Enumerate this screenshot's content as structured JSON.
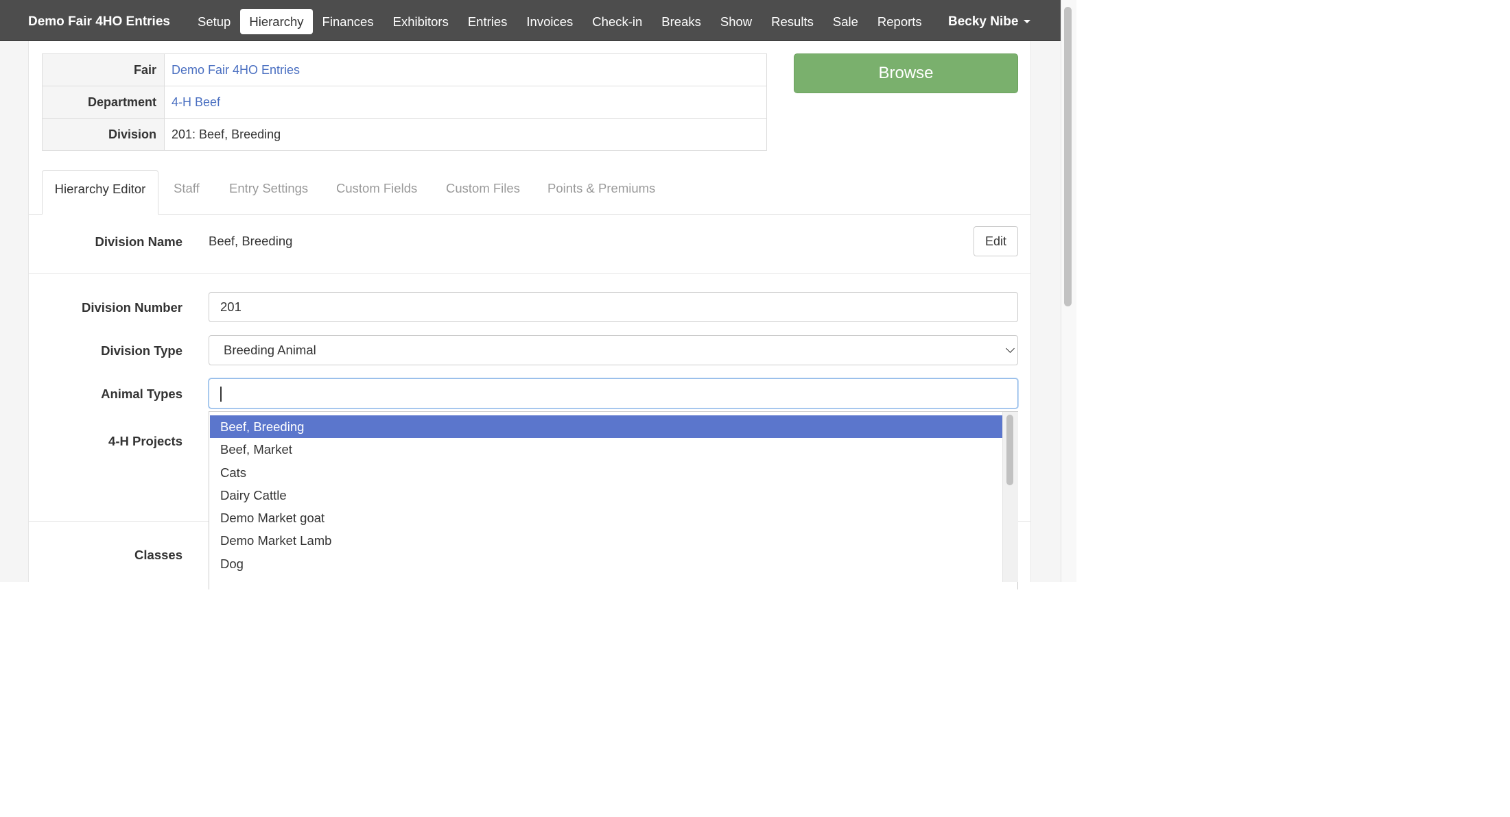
{
  "navbar": {
    "brand": "Demo Fair 4HO Entries",
    "items": [
      {
        "label": "Setup",
        "active": false
      },
      {
        "label": "Hierarchy",
        "active": true
      },
      {
        "label": "Finances",
        "active": false
      },
      {
        "label": "Exhibitors",
        "active": false
      },
      {
        "label": "Entries",
        "active": false
      },
      {
        "label": "Invoices",
        "active": false
      },
      {
        "label": "Check-in",
        "active": false
      },
      {
        "label": "Breaks",
        "active": false
      },
      {
        "label": "Show",
        "active": false
      },
      {
        "label": "Results",
        "active": false
      },
      {
        "label": "Sale",
        "active": false
      },
      {
        "label": "Reports",
        "active": false
      }
    ],
    "user": "Becky Nibe",
    "user_menu_icon": "caret-down-icon"
  },
  "info": {
    "fair_label": "Fair",
    "fair_value": "Demo Fair 4HO Entries",
    "department_label": "Department",
    "department_value": "4-H Beef",
    "division_label": "Division",
    "division_value": "201: Beef, Breeding"
  },
  "browse_button": "Browse",
  "tabs": [
    {
      "label": "Hierarchy Editor",
      "active": true
    },
    {
      "label": "Staff",
      "active": false
    },
    {
      "label": "Entry Settings",
      "active": false
    },
    {
      "label": "Custom Fields",
      "active": false
    },
    {
      "label": "Custom Files",
      "active": false
    },
    {
      "label": "Points & Premiums",
      "active": false
    }
  ],
  "form": {
    "division_name_label": "Division Name",
    "division_name_value": "Beef, Breeding",
    "edit_button": "Edit",
    "division_number_label": "Division Number",
    "division_number_value": "201",
    "division_type_label": "Division Type",
    "division_type_value": "Breeding Animal",
    "animal_types_label": "Animal Types",
    "animal_types_value": "",
    "projects_label": "4-H Projects",
    "classes_label": "Classes"
  },
  "animal_types_dropdown": {
    "highlighted_index": 0,
    "options": [
      "Beef, Breeding",
      "Beef, Market",
      "Cats",
      "Dairy Cattle",
      "Demo Market goat",
      "Demo Market Lamb",
      "Dog"
    ]
  },
  "colors": {
    "navbar_bg": "#4d4d4d",
    "link": "#4a6fc1",
    "browse_bg": "#7ab06d",
    "highlight_bg": "#5b76cc"
  }
}
